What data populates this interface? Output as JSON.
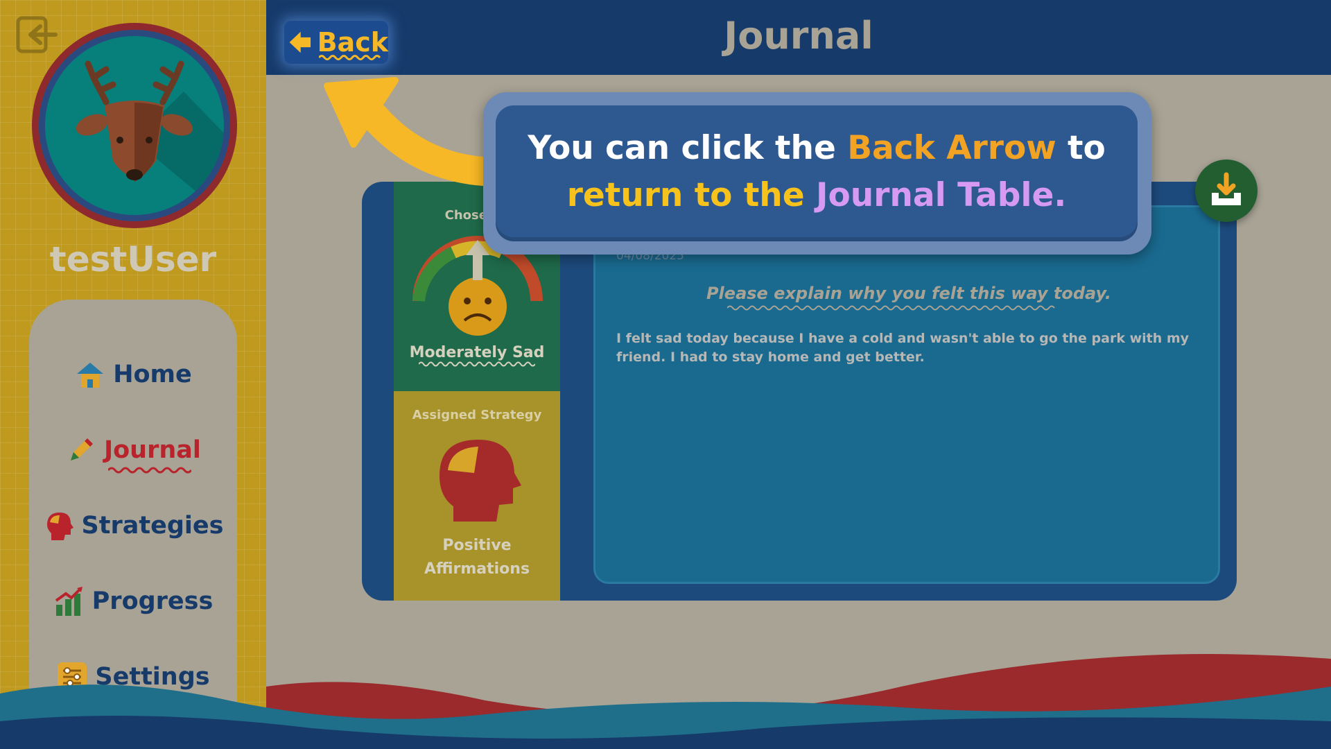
{
  "sidebar": {
    "username": "testUser",
    "nav": [
      {
        "label": "Home",
        "icon": "house-icon"
      },
      {
        "label": "Journal",
        "icon": "pencil-icon",
        "active": true
      },
      {
        "label": "Strategies",
        "icon": "head-icon"
      },
      {
        "label": "Progress",
        "icon": "chart-icon"
      },
      {
        "label": "Settings",
        "icon": "sliders-icon"
      }
    ]
  },
  "header": {
    "back_label": "Back",
    "title": "Journal"
  },
  "emotion": {
    "caption": "Chosen E",
    "name": "Moderately Sad"
  },
  "strategy": {
    "caption": "Assigned Strategy",
    "name_line1": "Positive",
    "name_line2": "Affirmations"
  },
  "entry": {
    "date": "04/08/2025",
    "prompt": "Please explain why you felt this way today.",
    "text": "I felt sad today because I have a cold and wasn't able to go the park with my friend. I had to stay home and get better."
  },
  "tooltip": {
    "part1": "You can click the ",
    "part2": "Back Arrow",
    "part3": " to",
    "part4": "return to the ",
    "part5": "Journal Table."
  },
  "colors": {
    "header": "#163a6a",
    "sidebar": "#bf9a1e",
    "accent_orange": "#f3a323",
    "accent_purple": "#d69af2",
    "active_red": "#b8232c"
  }
}
